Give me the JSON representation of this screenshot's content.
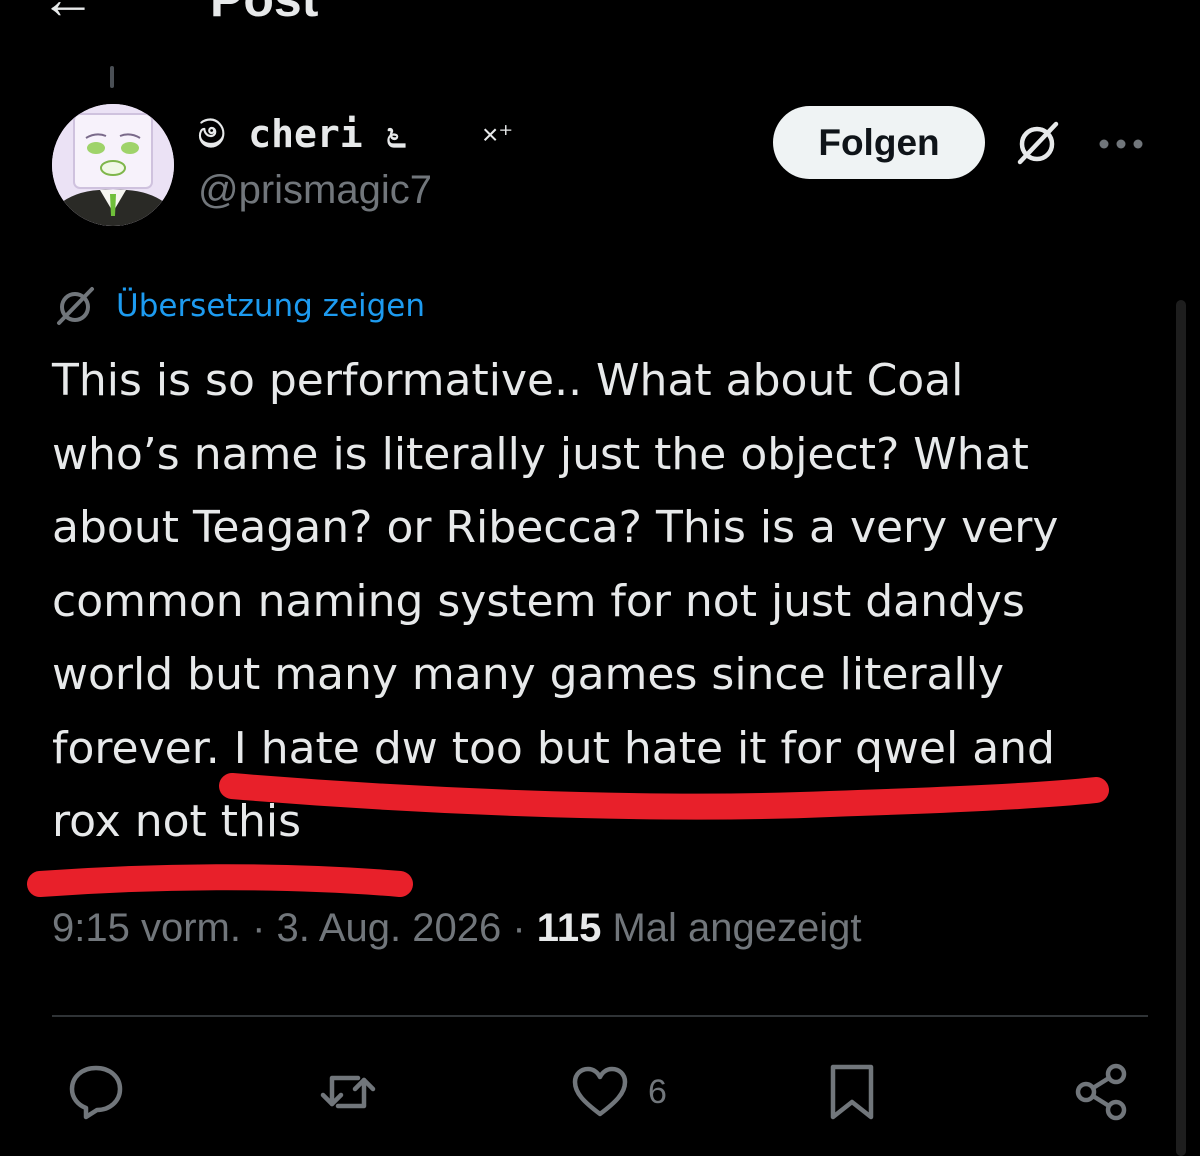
{
  "header": {
    "title": "Post",
    "back_icon": "arrow-left-icon"
  },
  "author": {
    "display_name": "ම cheri ೬",
    "name_suffix": "×⁺",
    "handle": "@prismagic7",
    "follow_label": "Folgen"
  },
  "post": {
    "translate_label": "Übersetzung zeigen",
    "lines": [
      "This is so performative.. What about Coal",
      "who’s name is literally just the object? What",
      "about Teagan? or Ribecca? This is a very very",
      "common naming system for not just dandys",
      "world but many many games since literally",
      "forever. I hate dw too but hate it for qwel and",
      "rox not this"
    ],
    "time": "9:15 vorm.",
    "date": "3. Aug. 2026",
    "views_count": "115",
    "views_label": "Mal angezeigt",
    "separator": "·"
  },
  "actions": {
    "reply_icon": "reply-icon",
    "repost_icon": "repost-icon",
    "like_icon": "heart-icon",
    "like_count": "6",
    "bookmark_icon": "bookmark-icon",
    "share_icon": "share-icon"
  },
  "colors": {
    "background": "#000000",
    "text": "#e7e9ea",
    "secondary_text": "#71767b",
    "link": "#1d9bf0",
    "annotation_red": "#e8202a"
  }
}
